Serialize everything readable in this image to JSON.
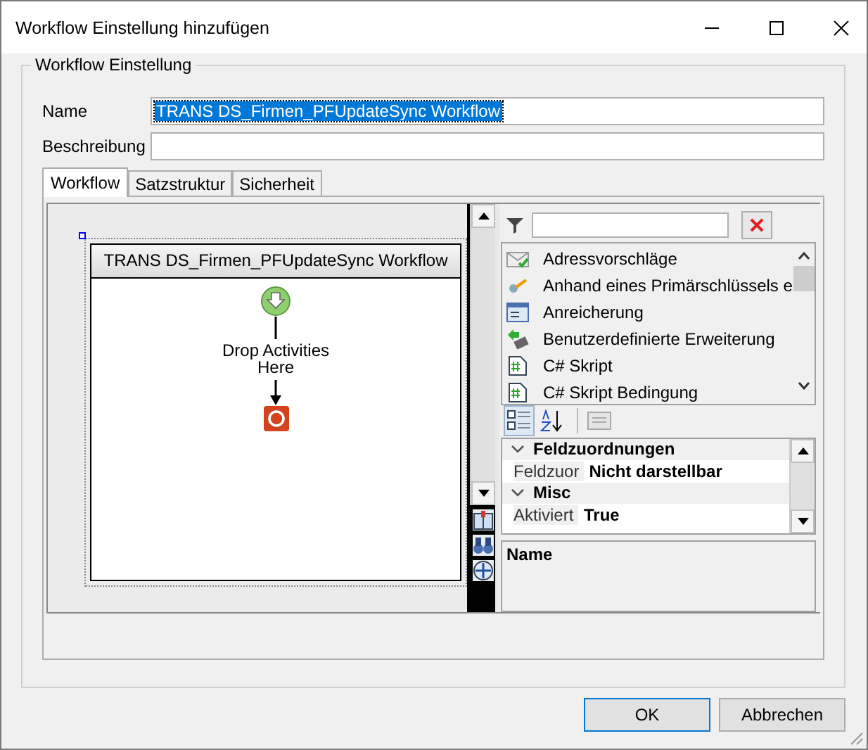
{
  "window": {
    "title": "Workflow Einstellung hinzufügen"
  },
  "group": {
    "title": "Workflow Einstellung"
  },
  "fields": [
    {
      "label": "Name",
      "value": "TRANS DS_Firmen_PFUpdateSync Workflow",
      "selected": true
    },
    {
      "label": "Beschreibung"
    }
  ],
  "tabs": [
    {
      "label": "Workflow",
      "selected": true
    },
    {
      "label": "Satzstruktur",
      "selected": false
    },
    {
      "label": "Sicherheit",
      "selected": false
    }
  ],
  "designer": {
    "title": "TRANS DS_Firmen_PFUpdateSync Workflow",
    "drop_hint": "Drop Activities Here"
  },
  "toolbox": {
    "items": [
      {
        "label": "Adressvorschläge",
        "kind": "envelope"
      },
      {
        "label": "Anhand eines Primärschlüssels e",
        "kind": "key"
      },
      {
        "label": "Anreicherung",
        "kind": "window"
      },
      {
        "label": "Benutzerdefinierte Erweiterung",
        "kind": "plugin"
      },
      {
        "label": "C# Skript",
        "kind": "script"
      },
      {
        "label": "C# Skript Bedingung",
        "kind": "script"
      }
    ]
  },
  "sort_buttons": [
    {
      "kind": "categorized",
      "selected": true
    },
    {
      "kind": "alphabetical",
      "selected": false
    }
  ],
  "properties": {
    "categories": [
      {
        "name": "Feldzuordnungen",
        "expanded": true,
        "rows": [
          {
            "name": "Feldzuor",
            "value": "Nicht darstellbar"
          }
        ]
      },
      {
        "name": "Misc",
        "expanded": true,
        "rows": [
          {
            "name": "Aktiviert",
            "value": "True"
          }
        ]
      }
    ]
  },
  "description": {
    "title": "Name"
  },
  "buttons": [
    {
      "label": "OK"
    },
    {
      "label": "Abbrechen"
    }
  ]
}
